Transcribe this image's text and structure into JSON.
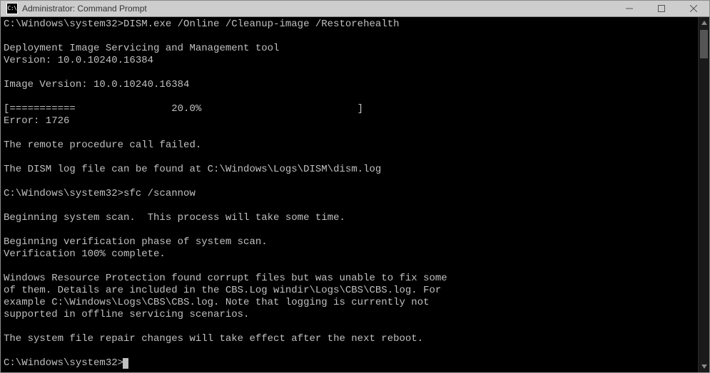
{
  "titlebar": {
    "icon_glyph": "C:\\",
    "title": "Administrator: Command Prompt"
  },
  "console": {
    "lines": [
      {
        "prompt": "C:\\Windows\\system32>",
        "cmd": "DISM.exe /Online /Cleanup-image /Restorehealth"
      },
      "",
      "Deployment Image Servicing and Management tool",
      "Version: 10.0.10240.16384",
      "",
      "Image Version: 10.0.10240.16384",
      "",
      "[===========                20.0%                          ]",
      "Error: 1726",
      "",
      "The remote procedure call failed.",
      "",
      "The DISM log file can be found at C:\\Windows\\Logs\\DISM\\dism.log",
      "",
      {
        "prompt": "C:\\Windows\\system32>",
        "cmd": "sfc /scannow"
      },
      "",
      "Beginning system scan.  This process will take some time.",
      "",
      "Beginning verification phase of system scan.",
      "Verification 100% complete.",
      "",
      "Windows Resource Protection found corrupt files but was unable to fix some",
      "of them. Details are included in the CBS.Log windir\\Logs\\CBS\\CBS.log. For",
      "example C:\\Windows\\Logs\\CBS\\CBS.log. Note that logging is currently not",
      "supported in offline servicing scenarios.",
      "",
      "The system file repair changes will take effect after the next reboot.",
      "",
      {
        "prompt": "C:\\Windows\\system32>",
        "cmd": "",
        "cursor": true
      }
    ]
  }
}
